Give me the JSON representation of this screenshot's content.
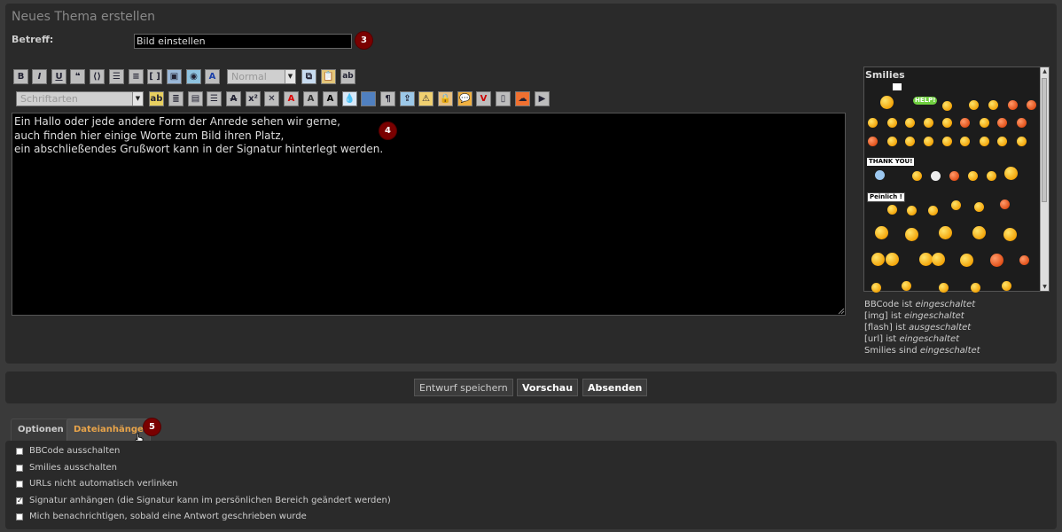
{
  "form": {
    "title": "Neues Thema erstellen",
    "subject_label": "Betreff:",
    "subject_value": "Bild einstellen"
  },
  "badges": [
    "3",
    "4",
    "5"
  ],
  "toolbar": {
    "bold_label": "B",
    "italic_label": "I",
    "underline_label": "U",
    "size_select": "Normal",
    "font_select": "Schriftarten",
    "ab_label": "ab"
  },
  "editor": {
    "lines": [
      "Ein Hallo oder jede andere Form der Anrede sehen wir gerne,",
      "auch finden hier einige Worte zum Bild ihren Platz,",
      "ein abschließendes Grußwort kann in der Signatur hinterlegt werden."
    ]
  },
  "smilies": {
    "title": "Smilies",
    "labels": {
      "help": "HELP!",
      "thanks": "THANK YOU!",
      "peinlich": "Peinlich !"
    }
  },
  "status": [
    {
      "name": "BBCode",
      "verb": "ist",
      "state": "eingeschaltet"
    },
    {
      "name": "[img]",
      "verb": "ist",
      "state": "eingeschaltet"
    },
    {
      "name": "[flash]",
      "verb": "ist",
      "state": "ausgeschaltet"
    },
    {
      "name": "[url]",
      "verb": "ist",
      "state": "eingeschaltet"
    },
    {
      "name": "Smilies",
      "verb": "sind",
      "state": "eingeschaltet"
    }
  ],
  "buttons": {
    "draft": "Entwurf speichern",
    "preview": "Vorschau",
    "submit": "Absenden"
  },
  "tabs": {
    "options": "Optionen",
    "attachments": "Dateianhänge"
  },
  "options": [
    {
      "label": "BBCode ausschalten",
      "checked": false
    },
    {
      "label": "Smilies ausschalten",
      "checked": false
    },
    {
      "label": "URLs nicht automatisch verlinken",
      "checked": false
    },
    {
      "label": "Signatur anhängen (die Signatur kann im persönlichen Bereich geändert werden)",
      "checked": true
    },
    {
      "label": "Mich benachrichtigen, sobald eine Antwort geschrieben wurde",
      "checked": false
    }
  ],
  "colors": {
    "badge": "#7a0000",
    "active_tab_text": "#e8a44a",
    "panel_bg": "#2a2a2a",
    "page_bg": "#3a3a3a"
  }
}
